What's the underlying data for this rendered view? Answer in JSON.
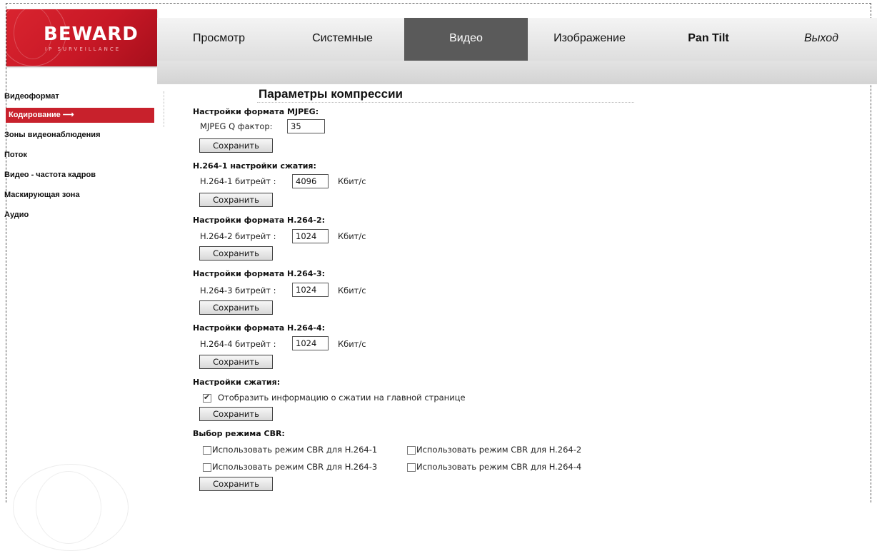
{
  "logo": {
    "brand": "BEWARD",
    "tagline": "IP SURVEILLANCE"
  },
  "nav": [
    {
      "label": "Просмотр",
      "active": false
    },
    {
      "label": "Системные",
      "active": false
    },
    {
      "label": "Видео",
      "active": true
    },
    {
      "label": "Изображение",
      "active": false
    },
    {
      "label": "Pan Tilt",
      "active": false
    },
    {
      "label": "Выход",
      "active": false
    }
  ],
  "sidebar": {
    "items": [
      {
        "label": "Видеоформат"
      },
      {
        "label": "Кодирование ⟶",
        "active": true
      },
      {
        "label": "Зоны видеонаблюдения"
      },
      {
        "label": "Поток"
      },
      {
        "label": "Видео - частота кадров"
      },
      {
        "label": "Маскирующая зона"
      },
      {
        "label": "Аудио"
      }
    ]
  },
  "main": {
    "title": "Параметры компрессии",
    "save_label": "Сохранить",
    "mjpeg": {
      "heading": "Настройки формата MJPEG:",
      "label": "MJPEG Q фактор:",
      "value": "35"
    },
    "h264_1": {
      "heading": "H.264-1 настройки сжатия:",
      "label": "H.264-1 битрейт :",
      "value": "4096",
      "unit": "Кбит/с"
    },
    "h264_2": {
      "heading": "Настройки формата H.264-2:",
      "label": "H.264-2 битрейт :",
      "value": "1024",
      "unit": "Кбит/с"
    },
    "h264_3": {
      "heading": "Настройки формата H.264-3:",
      "label": "H.264-3 битрейт :",
      "value": "1024",
      "unit": "Кбит/с"
    },
    "h264_4": {
      "heading": "Настройки формата H.264-4:",
      "label": "H.264-4 битрейт :",
      "value": "1024",
      "unit": "Кбит/с"
    },
    "compression": {
      "heading": "Настройки сжатия:",
      "show_info_label": "Отобразить информацию о сжатии на главной странице",
      "show_info_checked": true
    },
    "cbr": {
      "heading": "Выбор режима CBR:",
      "options": [
        {
          "label": "Использовать режим CBR для H.264-1",
          "checked": false
        },
        {
          "label": "Использовать режим CBR для H.264-2",
          "checked": false
        },
        {
          "label": "Использовать режим CBR для H.264-3",
          "checked": false
        },
        {
          "label": "Использовать режим CBR для H.264-4",
          "checked": false
        }
      ]
    }
  }
}
